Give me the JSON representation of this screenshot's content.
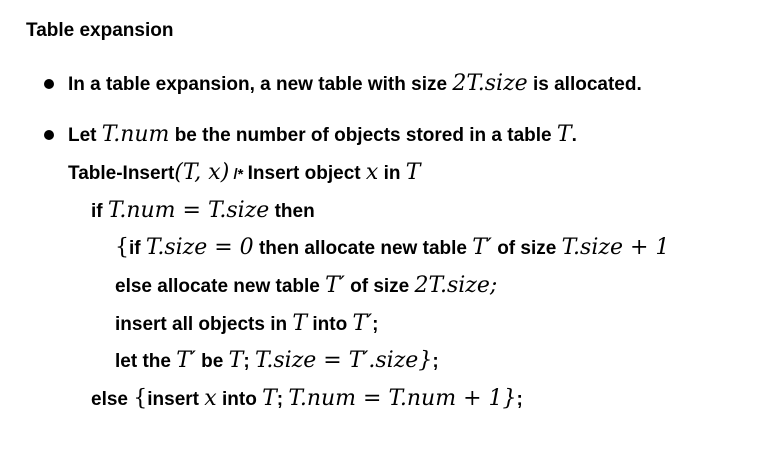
{
  "title": "Table expansion",
  "bullet1": {
    "t1": "In a table expansion, a new table with size ",
    "m1": "2T.size",
    "t2": " is allocated."
  },
  "bullet2": {
    "t1": "Let ",
    "m1": "T.num",
    "t2": " be the number of objects stored in a table ",
    "m2": "T",
    "t3": "."
  },
  "algo": {
    "l1": {
      "t1": "Table-Insert",
      "m1": "(T, x)",
      "t2": " /* ",
      "t3": "Insert object ",
      "m2": "x",
      "t4": " in ",
      "m3": "T"
    },
    "l2": {
      "t1": "if ",
      "m1": "T.num = T.size",
      "t2": " then"
    },
    "l3": {
      "m1": "{",
      "t1": "if ",
      "m2": "T.size = 0",
      "t2": " then allocate new table ",
      "m3": "T′",
      "t3": " of size ",
      "m4": "T.size + 1"
    },
    "l4": {
      "t1": "else allocate new table ",
      "m1": "T′",
      "t2": " of size ",
      "m2": "2T.size;"
    },
    "l5": {
      "t1": "insert all objects in ",
      "m1": "T",
      "t2": " into ",
      "m2": "T′",
      "t3": ";"
    },
    "l6": {
      "t1": "let the ",
      "m1": "T′",
      "t2": " be ",
      "m2": "T",
      "t3": "; ",
      "m3": "T.size = T′.size}",
      "t4": ";"
    },
    "l7": {
      "t1": "else ",
      "m1": "{",
      "t2": "insert ",
      "m2": "x",
      "t3": " into ",
      "m3": "T",
      "t4": "; ",
      "m4": "T.num = T.num + 1}",
      "t5": ";"
    }
  }
}
